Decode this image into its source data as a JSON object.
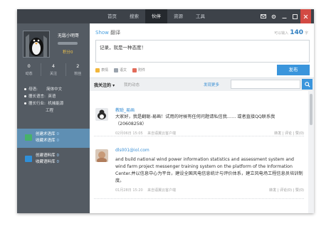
{
  "nav": [
    "首页",
    "搜索",
    "伙伴",
    "资源",
    "工具"
  ],
  "active_nav_index": 2,
  "window_controls": [
    "mail-icon",
    "gear-icon",
    "minimize-icon",
    "maximize-icon",
    "close-icon"
  ],
  "profile": {
    "username": "无敌小明哥",
    "score": "积分0",
    "stats": [
      {
        "value": "0",
        "label": "动态"
      },
      {
        "value": "4",
        "label": "关注"
      },
      {
        "value": "2",
        "label": "粉丝"
      }
    ],
    "info": [
      {
        "label": "母语:",
        "value": "简体中文"
      },
      {
        "label": "擅长语言:",
        "value": "英语"
      },
      {
        "label": "擅长行业:",
        "value": "机械能源"
      },
      {
        "label": "",
        "value": "工程"
      }
    ]
  },
  "libraries": [
    {
      "line1": "创建术语库",
      "count1": "0",
      "line2": "收藏术语库",
      "count2": "0",
      "color": "#47b26a"
    },
    {
      "line1": "创建语料库",
      "count1": "0",
      "line2": "收藏语料库",
      "count2": "0",
      "color": "#2f8fd8"
    }
  ],
  "compose": {
    "show_label": "Show",
    "show_sub": "翻译",
    "counter_prefix": "可以输入",
    "counter_value": "140",
    "counter_suffix": "字",
    "text": "记录，就是一种态度！",
    "tools": [
      "表情",
      "语文",
      "附件"
    ],
    "publish": "发布"
  },
  "filter": {
    "tab_active": "我关注的 ▾",
    "tab_other": "我的动态",
    "more": "发现更多"
  },
  "posts": [
    {
      "author": "教聪_易画",
      "text": "大家好，我是翻聪-易画！试用的时候有任何问题请私信我…… 或者直接QQ联系我（20608258）",
      "time": "02月06日 15:05",
      "source": "来自语翼云客户端",
      "actions": "转发 | 评论 | 赞(0)"
    },
    {
      "author": "dls001@iol.com",
      "text": "and build national wind power information statistics and assessment system and wind farm project messenger training system on the platform of the Information Center.并以信息中心为平台，建设全国风电信息统计与评价体系，建立风电场工程信息员培训制度。",
      "time": "01月28日 15:20",
      "source": "来自语翼云客户端",
      "actions": "转发 | 评论(0) | 赞(0)"
    }
  ]
}
